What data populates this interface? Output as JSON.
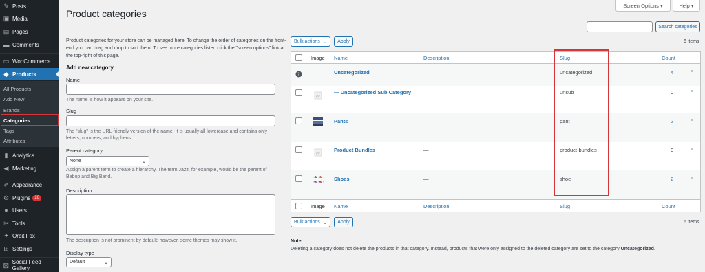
{
  "sidebar": {
    "items": [
      {
        "label": "Posts",
        "icon": "pin-icon"
      },
      {
        "label": "Media",
        "icon": "media-icon"
      },
      {
        "label": "Pages",
        "icon": "pages-icon"
      },
      {
        "label": "Comments",
        "icon": "comments-icon"
      },
      {
        "label": "WooCommerce",
        "icon": "woocommerce-icon"
      },
      {
        "label": "Products",
        "icon": "products-icon"
      },
      {
        "label": "Analytics",
        "icon": "analytics-icon"
      },
      {
        "label": "Marketing",
        "icon": "marketing-icon"
      },
      {
        "label": "Appearance",
        "icon": "appearance-icon"
      },
      {
        "label": "Plugins",
        "icon": "plugins-icon",
        "badge": "10"
      },
      {
        "label": "Users",
        "icon": "users-icon"
      },
      {
        "label": "Tools",
        "icon": "tools-icon"
      },
      {
        "label": "Orbit Fox",
        "icon": "orbit-fox-icon"
      },
      {
        "label": "Settings",
        "icon": "settings-icon"
      },
      {
        "label": "Social Feed Gallery",
        "icon": "social-feed-icon"
      }
    ],
    "submenu": [
      "All Products",
      "Add New",
      "Brands",
      "Categories",
      "Tags",
      "Attributes"
    ]
  },
  "header": {
    "title": "Product categories",
    "screen_options": "Screen Options ▾",
    "help": "Help ▾"
  },
  "form": {
    "intro": "Product categories for your store can be managed here. To change the order of categories on the front-end you can drag and drop to sort them. To see more categories listed click the \"screen options\" link at the top-right of this page.",
    "heading": "Add new category",
    "name_label": "Name",
    "name_help": "The name is how it appears on your site.",
    "slug_label": "Slug",
    "slug_help": "The \"slug\" is the URL-friendly version of the name. It is usually all lowercase and contains only letters, numbers, and hyphens.",
    "parent_label": "Parent category",
    "parent_value": "None",
    "parent_help": "Assign a parent term to create a hierarchy. The term Jazz, for example, would be the parent of Bebop and Big Band.",
    "description_label": "Description",
    "description_help": "The description is not prominent by default; however, some themes may show it.",
    "display_type_label": "Display type",
    "display_type_value": "Default"
  },
  "list": {
    "search_button": "Search categories",
    "bulk_actions": "Bulk actions",
    "apply": "Apply",
    "items_count": "6 items",
    "columns": {
      "image": "Image",
      "name": "Name",
      "description": "Description",
      "slug": "Slug",
      "count": "Count"
    },
    "rows": [
      {
        "name": "Uncategorized",
        "description": "—",
        "slug": "uncategorized",
        "count": "4",
        "thumb": "help-icon"
      },
      {
        "name": "— Uncategorized Sub Category",
        "description": "—",
        "slug": "unsub",
        "count": "0",
        "thumb": "placeholder-icon"
      },
      {
        "name": "Pants",
        "description": "—",
        "slug": "pant",
        "count": "2",
        "thumb": "pants-icon"
      },
      {
        "name": "Product Bundles",
        "description": "—",
        "slug": "product-bundles",
        "count": "0",
        "thumb": "placeholder-icon"
      },
      {
        "name": "Shoes",
        "description": "—",
        "slug": "shoe",
        "count": "2",
        "thumb": "shoes-icon"
      }
    ]
  },
  "note": {
    "label": "Note:",
    "text": "Deleting a category does not delete the products in that category. Instead, products that were only assigned to the deleted category are set to the category ",
    "bold": "Uncategorized",
    "end": "."
  }
}
